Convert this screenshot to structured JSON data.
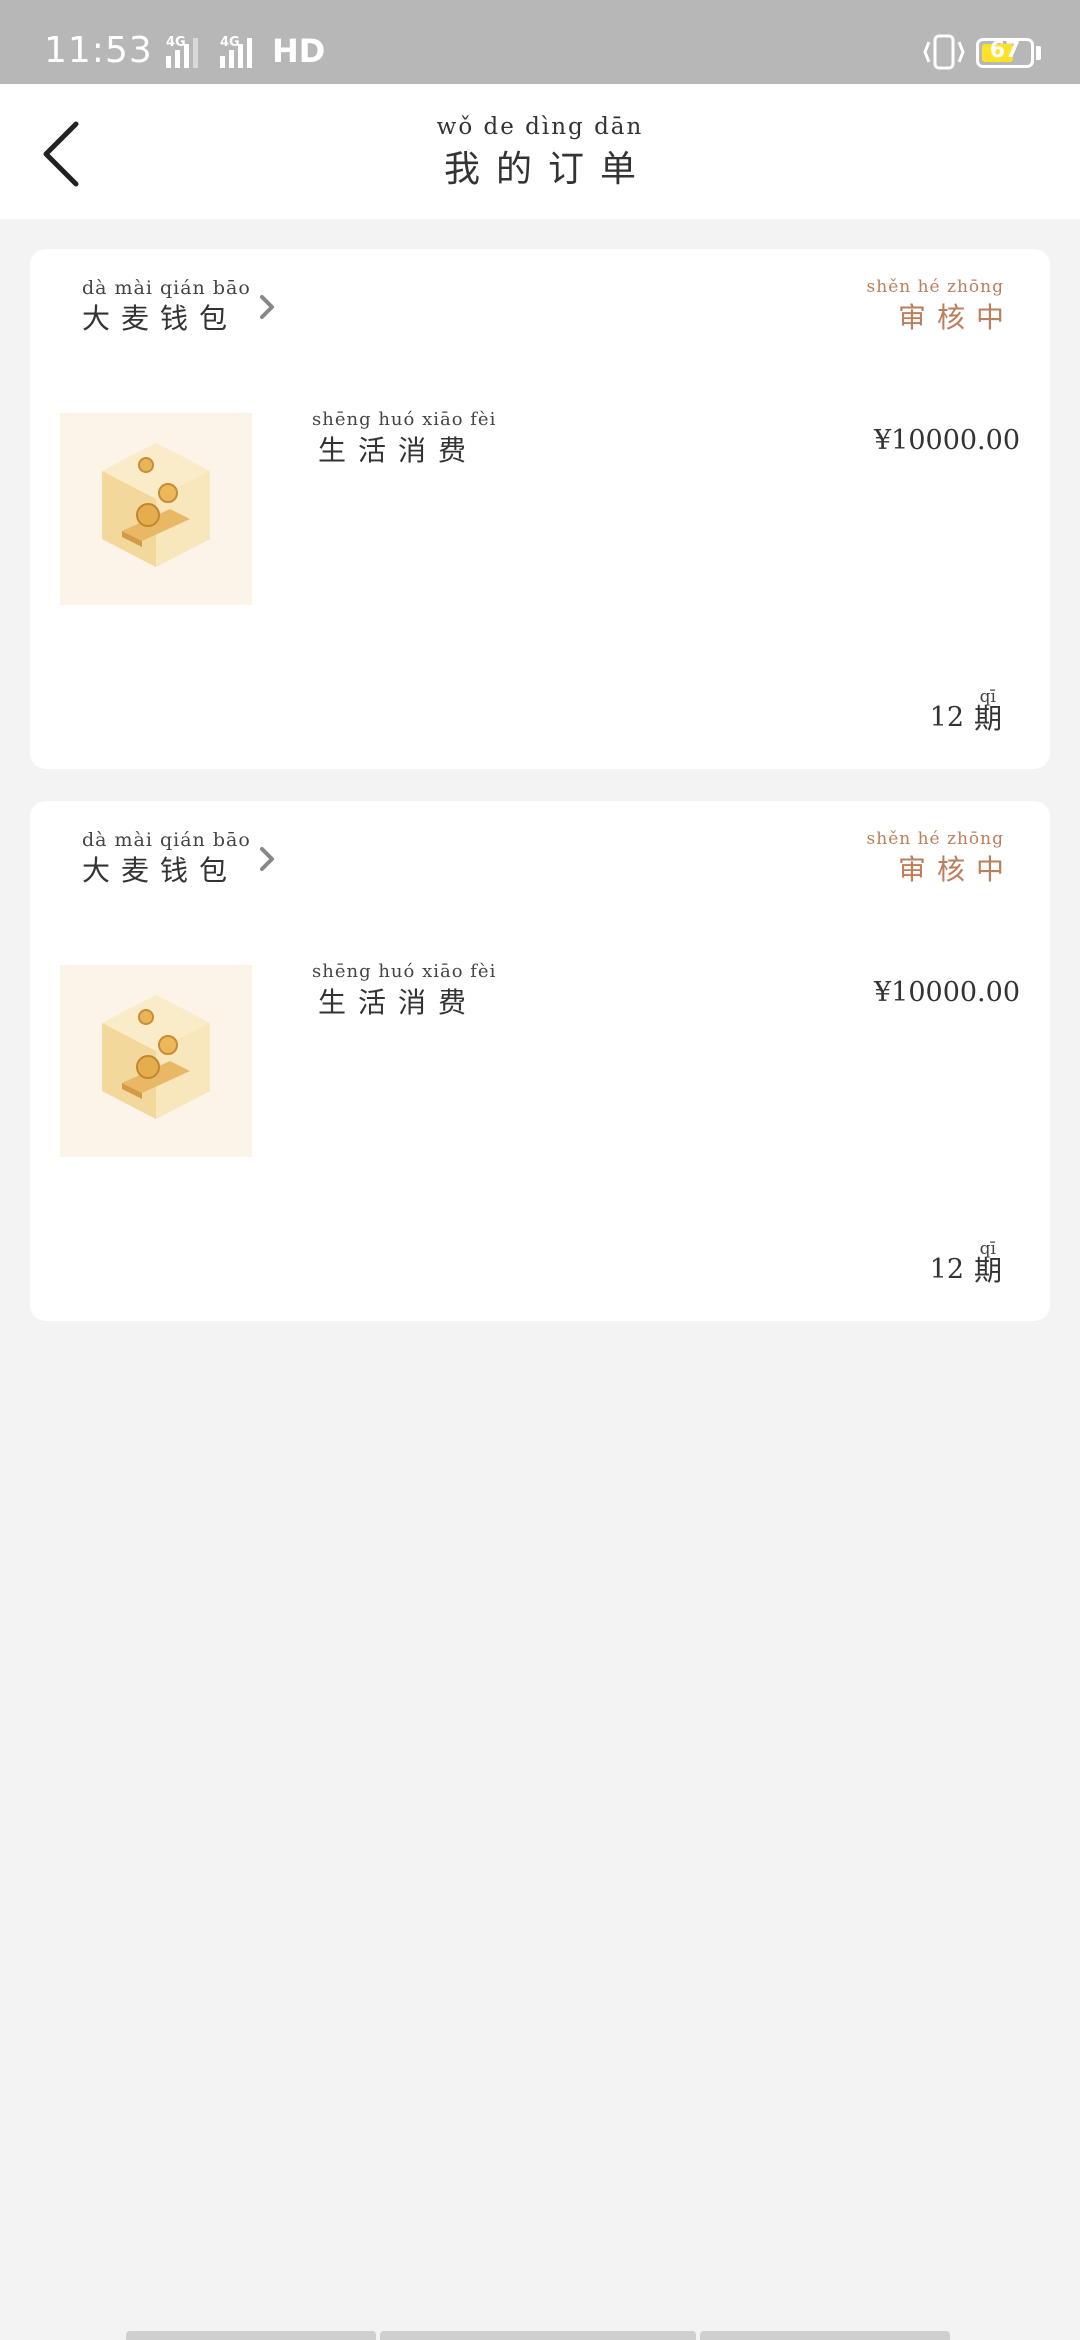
{
  "status_bar": {
    "time": "11:53",
    "network1": "4G",
    "network2": "4G",
    "hd": "HD",
    "battery": "67",
    "battery_level": 0.67,
    "battery_color": "#ffe227"
  },
  "header": {
    "title_pinyin": "wǒ  de  dìng dān",
    "title": "我的订单",
    "back_icon": "chevron-left-icon"
  },
  "orders": [
    {
      "shop_pinyin": "dà  mài qián bāo",
      "shop_name": "大麦钱包",
      "status_pinyin": "shěn  hé  zhōng",
      "status": "审核中",
      "product_pinyin": "shēng huó xiāo  fèi",
      "product": "生活消费",
      "price": "¥10000.00",
      "term_count": "12",
      "term_pinyin": "qī",
      "term_unit": "期"
    },
    {
      "shop_pinyin": "dà  mài qián bāo",
      "shop_name": "大麦钱包",
      "status_pinyin": "shěn  hé  zhōng",
      "status": "审核中",
      "product_pinyin": "shēng huó xiāo  fèi",
      "product": "生活消费",
      "price": "¥10000.00",
      "term_count": "12",
      "term_pinyin": "qī",
      "term_unit": "期"
    }
  ],
  "colors": {
    "status_accent": "#bd7e5c",
    "background": "#f3f3f3",
    "status_bar": "#b7b7b7"
  }
}
